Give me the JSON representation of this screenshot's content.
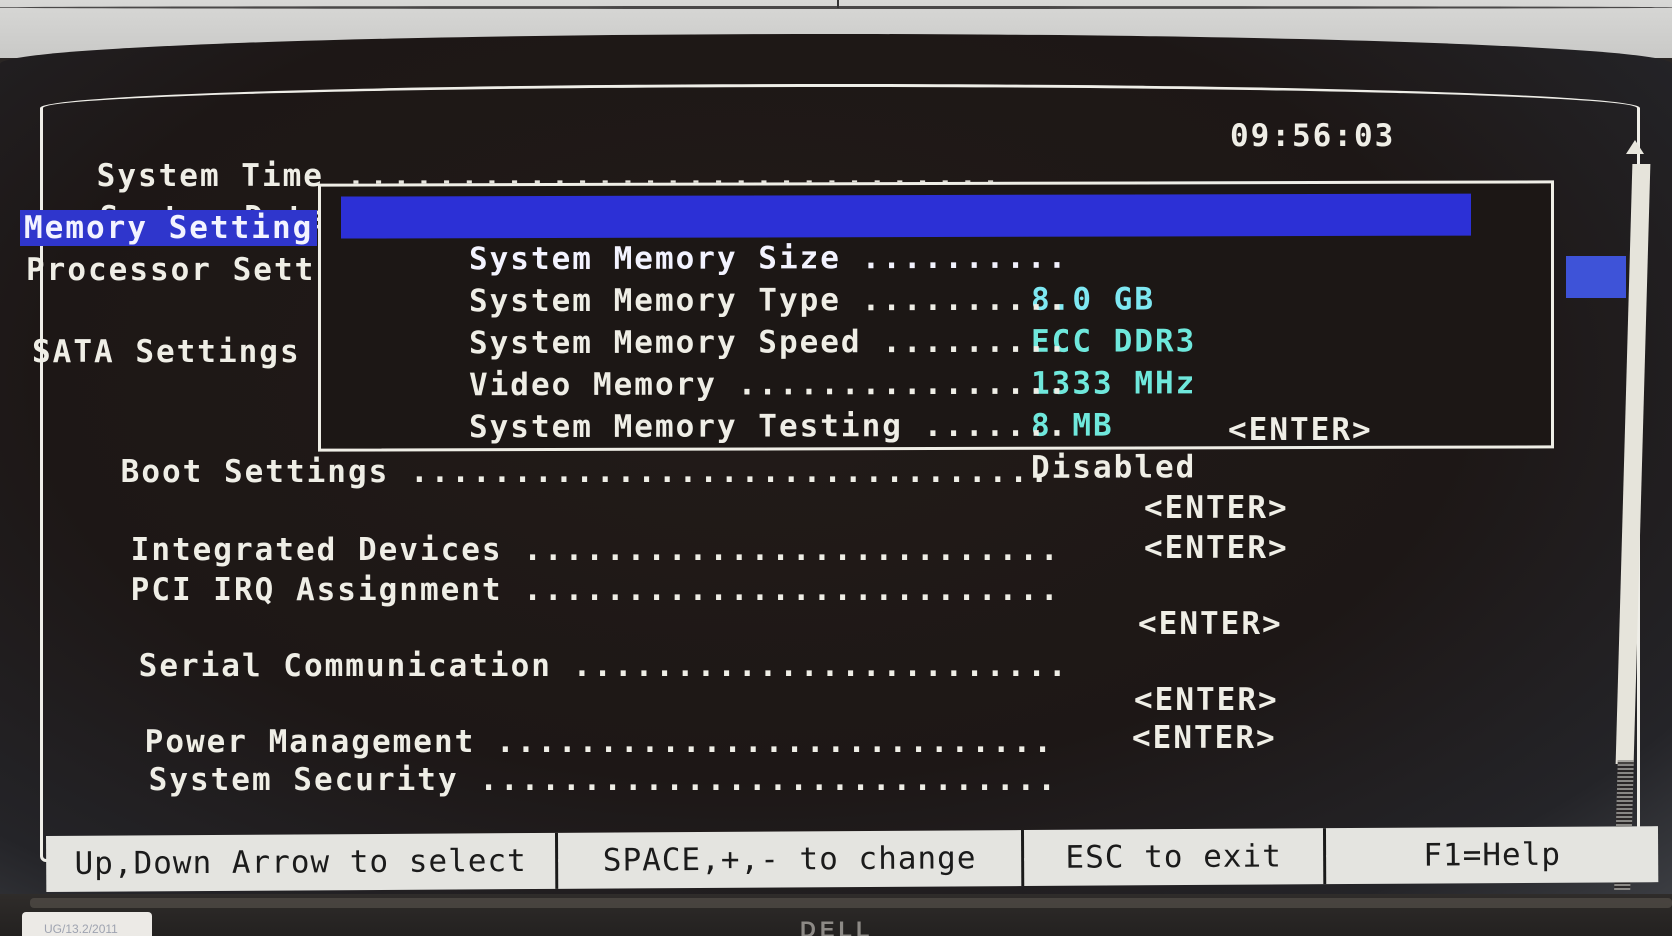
{
  "header": {
    "system_time": {
      "label": "System Time",
      "dots": " ............................. ",
      "value": "09:56:03"
    },
    "system_date": {
      "label": "System Date",
      "dots": " .."
    }
  },
  "sidebar": {
    "items": [
      {
        "label": "Memory Setting",
        "selected": true
      },
      {
        "label": "Processor Sett",
        "selected": false
      },
      {
        "label": "SATA Settings",
        "selected": false
      }
    ]
  },
  "memory_popup": {
    "rows": [
      {
        "label": "System Memory Size",
        "dots": " ..........",
        "value": "8.0 GB",
        "selected": true
      },
      {
        "label": "System Memory Type",
        "dots": " ..........",
        "value": "ECC DDR3",
        "selected": false
      },
      {
        "label": "System Memory Speed",
        "dots": " .........",
        "value": "1333 MHz",
        "selected": false
      },
      {
        "label": "Video Memory",
        "dots": " ................",
        "value": "8 MB",
        "selected": false
      },
      {
        "label": "System Memory Testing",
        "dots": " .......",
        "value": "Disabled",
        "selected": false
      }
    ]
  },
  "menu": {
    "items": [
      {
        "label": "Boot Settings",
        "dots": " ...............................",
        "action": "<ENTER>"
      },
      {
        "label": "Integrated Devices",
        "dots": " ..........................",
        "action": "<ENTER>"
      },
      {
        "label": "PCI IRQ Assignment",
        "dots": " ..........................",
        "action": "<ENTER>"
      },
      {
        "label": "Serial Communication",
        "dots": " ........................",
        "action": "<ENTER>"
      },
      {
        "label": "Power Management",
        "dots": " ...........................",
        "action": "<ENTER>"
      },
      {
        "label": "System Security",
        "dots": " ............................",
        "action": "<ENTER>"
      }
    ]
  },
  "help_bar": {
    "items": [
      "Up,Down Arrow to select",
      "SPACE,+,- to change",
      "ESC to exit",
      "F1=Help"
    ]
  },
  "bezel": {
    "sticker_text": "UG/13.2/2011",
    "brand_logo": "DELL"
  },
  "colors": {
    "highlight": "#2c30d6",
    "value_text": "#6fe8dc",
    "foreground": "#efeee6",
    "background": "#1c1715",
    "help_bar": "#e4e4e0"
  }
}
